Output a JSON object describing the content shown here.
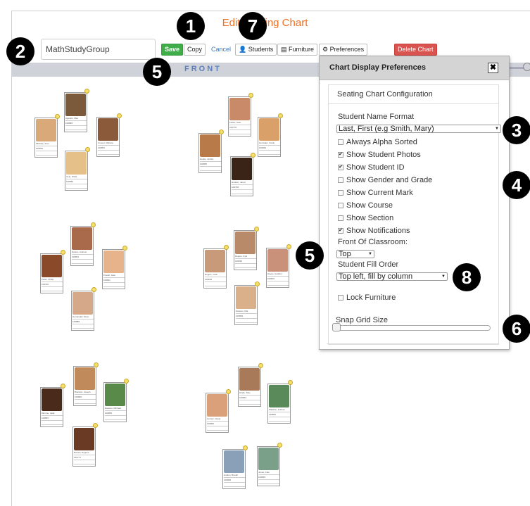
{
  "header": {
    "title": "Edit Seating Chart",
    "chart_name": "MathStudyGroup"
  },
  "toolbar": {
    "save": "Save",
    "copy": "Copy",
    "cancel": "Cancel",
    "students": "Students",
    "furniture": "Furniture",
    "preferences": "Preferences",
    "delete_chart": "Delete Chart"
  },
  "front_label": "FRONT",
  "dialog": {
    "title": "Chart Display Preferences",
    "close": "✖",
    "section": "Seating Chart Configuration",
    "name_format_label": "Student Name Format",
    "name_format_value": "Last, First (e.g Smith, Mary)",
    "options": [
      {
        "label": "Always Alpha Sorted",
        "checked": false
      },
      {
        "label": "Show Student Photos",
        "checked": true
      },
      {
        "label": "Show Student ID",
        "checked": true
      },
      {
        "label": "Show Gender and Grade",
        "checked": false
      },
      {
        "label": "Show Current Mark",
        "checked": false
      },
      {
        "label": "Show Course",
        "checked": false
      },
      {
        "label": "Show Section",
        "checked": false
      },
      {
        "label": "Show Notifications",
        "checked": true
      }
    ],
    "front_label": "Front Of Classroom:",
    "front_value": "Top",
    "fill_label": "Student Fill Order",
    "fill_value": "Top left, fill by column",
    "lock_label": "Lock Furniture",
    "lock_checked": false,
    "snap_label": "Snap Grid Size",
    "snap_value": 0
  },
  "callouts": [
    "1",
    "2",
    "3",
    "4",
    "5",
    "5",
    "6",
    "7",
    "8"
  ],
  "students": [
    {
      "name": "Agostini, Max",
      "id": "100895",
      "color": "#7a5a3a",
      "pin": true
    },
    {
      "name": "Michael, Joan",
      "id": "100552",
      "color": "#d9a97a",
      "pin": true
    },
    {
      "name": "Crosen, Melissa",
      "id": "100851",
      "color": "#8a5a3a",
      "pin": true
    },
    {
      "name": "Cole, Olivia",
      "id": "100853",
      "color": "#e6c089",
      "pin": true
    },
    {
      "name": "Fisher, Jean",
      "id": "100778",
      "color": "#c98a6a",
      "pin": true
    },
    {
      "name": "Hooks, Jordan",
      "id": "100850",
      "color": "#b97a4a",
      "pin": true
    },
    {
      "name": "Gonzalez, Frank",
      "id": "100844",
      "color": "#d9a06a",
      "pin": true
    },
    {
      "name": "Hudson, Jared",
      "id": "100798",
      "color": "#3a2418",
      "pin": true
    },
    {
      "name": "Nelson, Andrew",
      "id": "100861",
      "color": "#a86a4a",
      "pin": true
    },
    {
      "name": "Parks, Phillip",
      "id": "100720",
      "color": "#8a4a2a",
      "pin": true
    },
    {
      "name": "Powell, Julia",
      "id": "100811",
      "color": "#e6b38a",
      "pin": true
    },
    {
      "name": "Hernandez, Rose",
      "id": "100888",
      "color": "#d6a88a",
      "pin": true
    },
    {
      "name": "Rogers, Colin",
      "id": "100818",
      "color": "#c99a7a",
      "pin": true
    },
    {
      "name": "Rogers, Kyle",
      "id": "100819",
      "color": "#b98a6a",
      "pin": true
    },
    {
      "name": "Hayes, Heather",
      "id": "100870",
      "color": "#c9907a",
      "pin": true
    },
    {
      "name": "Dawson, Mia",
      "id": "100899",
      "color": "#d9b08a",
      "pin": true
    },
    {
      "name": "Monroe, Jada",
      "id": "100845",
      "color": "#4a2a1a",
      "pin": true
    },
    {
      "name": "Brandon, Joseph",
      "id": "100860",
      "color": "#c08a5a",
      "pin": true
    },
    {
      "name": "Dawson, Michael",
      "id": "100856",
      "color": "#5a8a4a",
      "pin": true
    },
    {
      "name": "Ramos, Eugene",
      "id": "100777",
      "color": "#6a3a24",
      "pin": true
    },
    {
      "name": "Gomez, Oscar",
      "id": "100866",
      "color": "#d9a07a",
      "pin": true
    },
    {
      "name": "Hinds, Toby",
      "id": "100843",
      "color": "#a87a5a",
      "pin": true
    },
    {
      "name": "Waldron, Joshua",
      "id": "100862",
      "color": "#5a8a5a",
      "pin": true
    },
    {
      "name": "Holden, Brandt",
      "id": "100808",
      "color": "#8aa0b8",
      "pin": true
    },
    {
      "name": "Jones, Cole",
      "id": "100845",
      "color": "#7aa08a",
      "pin": true
    }
  ]
}
